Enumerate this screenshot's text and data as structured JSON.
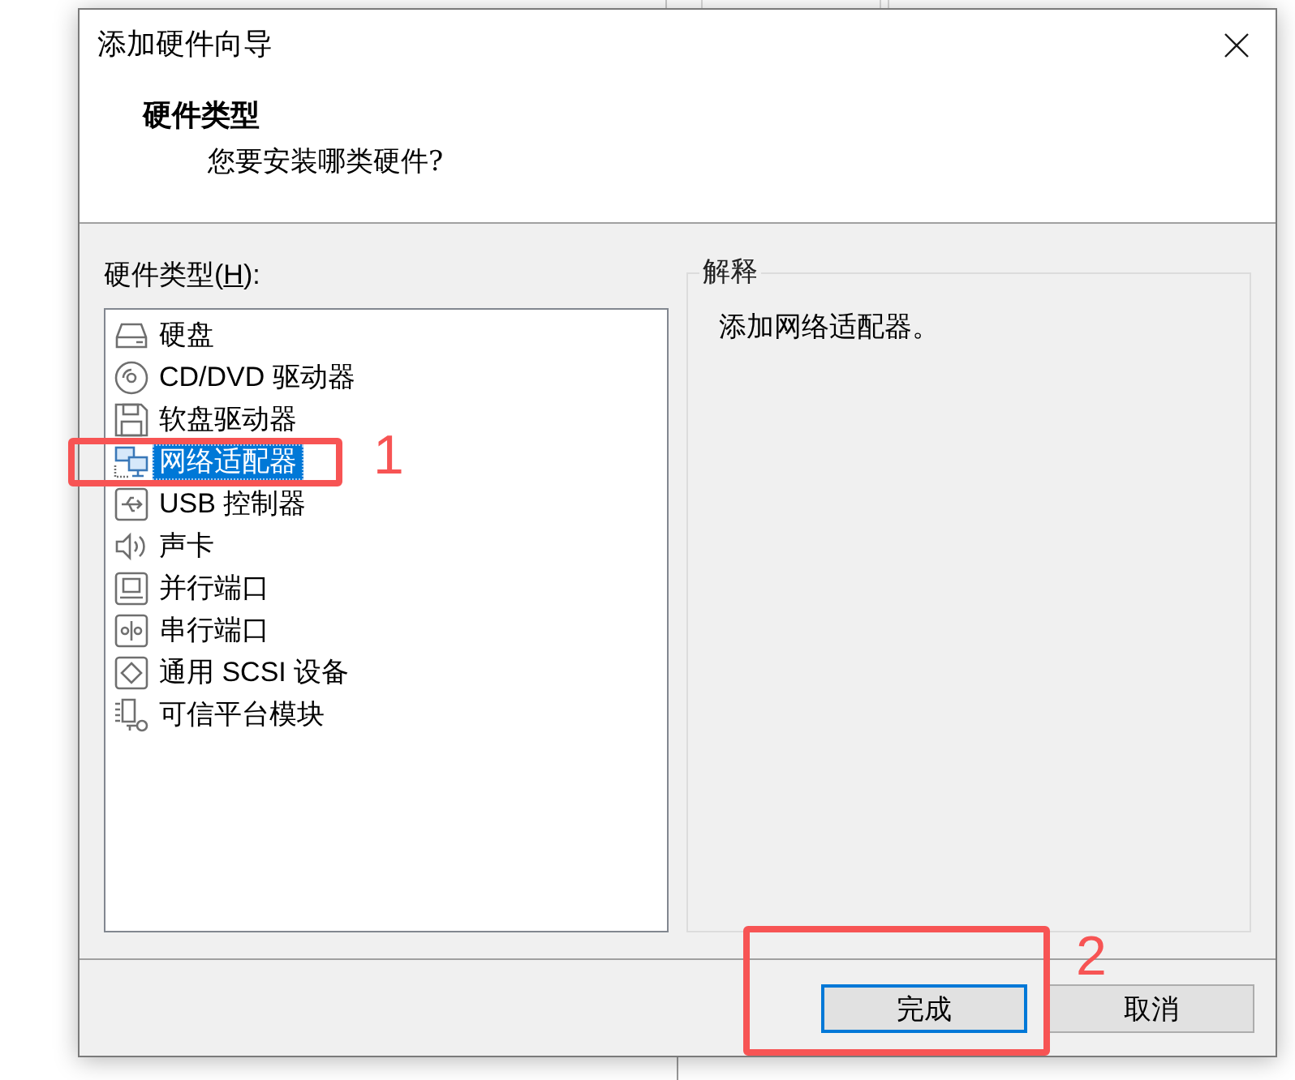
{
  "window": {
    "title": "添加硬件向导"
  },
  "header": {
    "title": "硬件类型",
    "subtitle": "您要安装哪类硬件?"
  },
  "hardware_list": {
    "label": {
      "text_before": "硬件类型(",
      "access_key": "H",
      "text_after": "):"
    },
    "items": [
      {
        "kind": "disk",
        "label": "硬盘",
        "selected": false
      },
      {
        "kind": "cd",
        "label": "CD/DVD 驱动器",
        "selected": false
      },
      {
        "kind": "floppy",
        "label": "软盘驱动器",
        "selected": false
      },
      {
        "kind": "network",
        "label": "网络适配器",
        "selected": true,
        "annotation": "1"
      },
      {
        "kind": "usb",
        "label": "USB 控制器",
        "selected": false
      },
      {
        "kind": "sound",
        "label": "声卡",
        "selected": false
      },
      {
        "kind": "parallel",
        "label": "并行端口",
        "selected": false
      },
      {
        "kind": "serial",
        "label": "串行端口",
        "selected": false
      },
      {
        "kind": "scsi",
        "label": "通用 SCSI 设备",
        "selected": false
      },
      {
        "kind": "tpm",
        "label": "可信平台模块",
        "selected": false
      }
    ]
  },
  "explanation": {
    "title": "解释",
    "text": "添加网络适配器。"
  },
  "buttons": [
    {
      "label": "完成",
      "default": true,
      "annotation": "2"
    },
    {
      "label": "取消",
      "default": false
    }
  ]
}
